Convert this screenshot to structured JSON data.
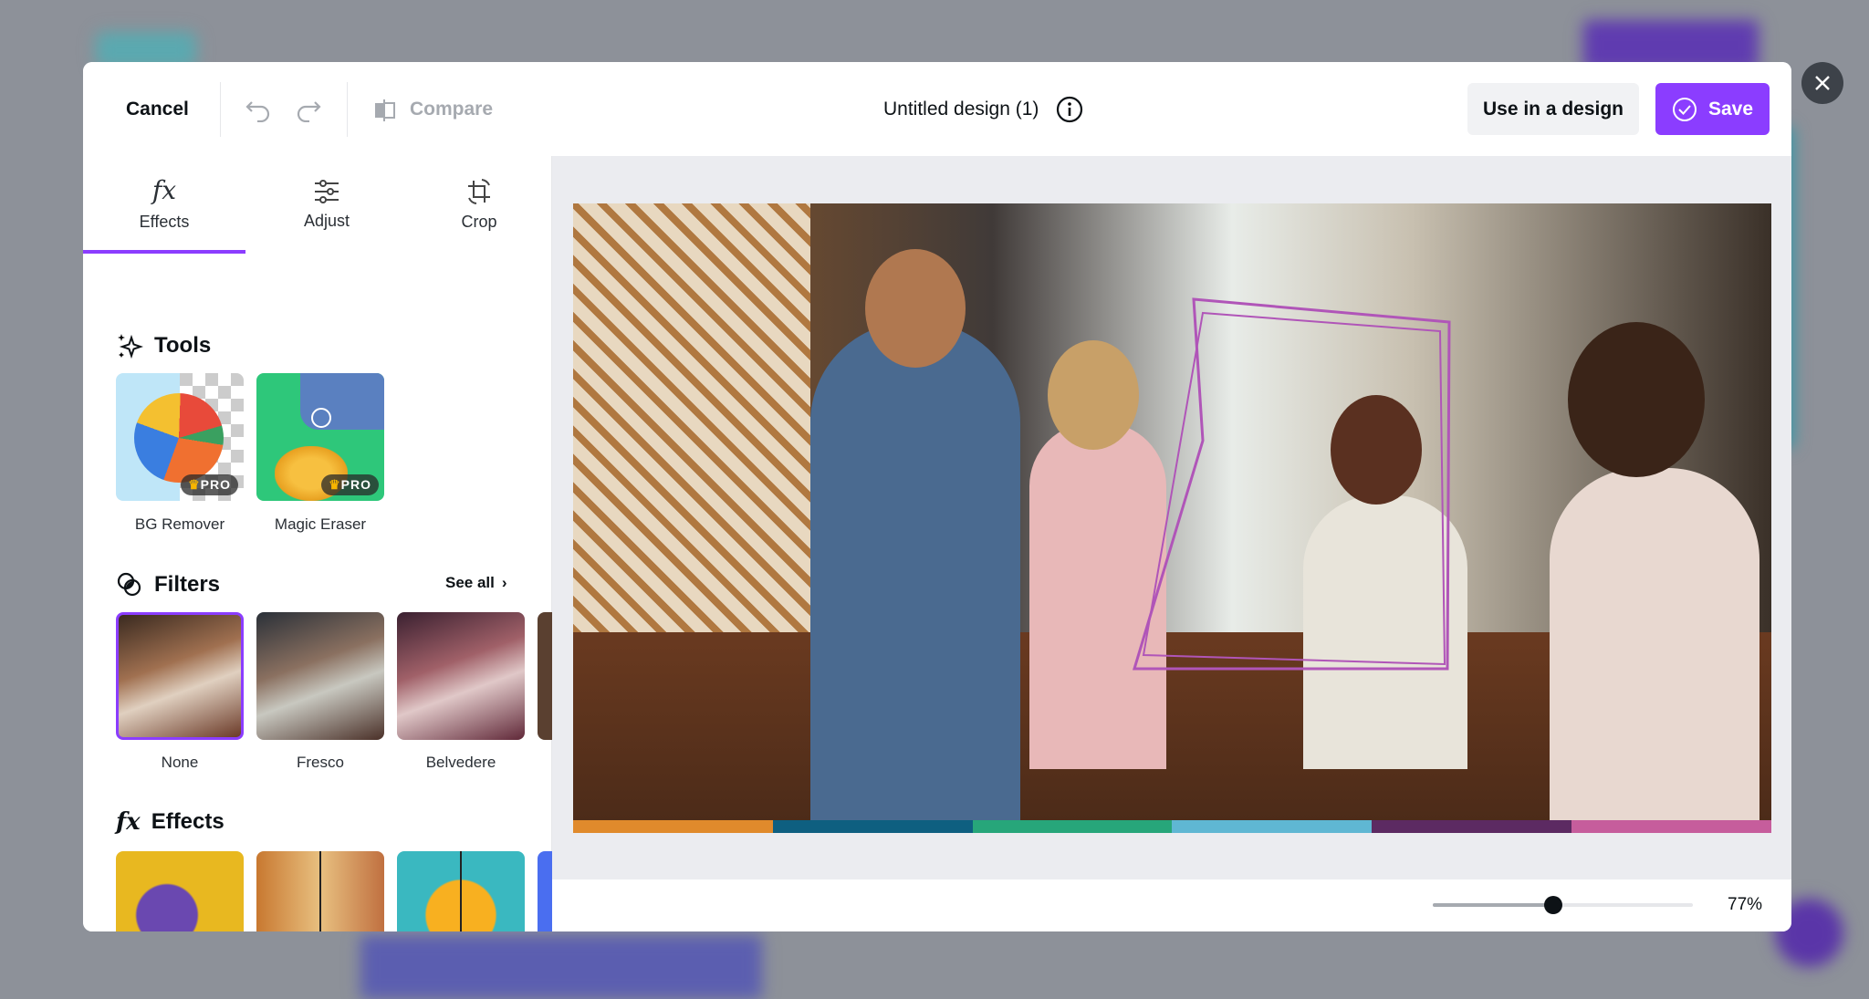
{
  "header": {
    "cancel": "Cancel",
    "compare": "Compare",
    "title": "Untitled design (1)",
    "use_in_design": "Use in a design",
    "save": "Save"
  },
  "tabs": [
    {
      "label": "Effects",
      "icon": "fx-icon",
      "active": true
    },
    {
      "label": "Adjust",
      "icon": "sliders-icon"
    },
    {
      "label": "Crop",
      "icon": "crop-rotate-icon"
    }
  ],
  "tools": {
    "heading": "Tools",
    "items": [
      {
        "label": "BG Remover",
        "badge": "PRO"
      },
      {
        "label": "Magic Eraser",
        "badge": "PRO"
      }
    ]
  },
  "filters": {
    "heading": "Filters",
    "see_all": "See all",
    "items": [
      {
        "label": "None",
        "selected": true
      },
      {
        "label": "Fresco"
      },
      {
        "label": "Belvedere"
      }
    ]
  },
  "effects": {
    "heading": "Effects"
  },
  "zoom": {
    "value_label": "77%",
    "percent": 77
  },
  "colors": {
    "accent": "#8b3dff",
    "strip": [
      "#e08a2c",
      "#0e5f80",
      "#27a67a",
      "#5fb7d3",
      "#5c2a62",
      "#c65d9c"
    ]
  }
}
